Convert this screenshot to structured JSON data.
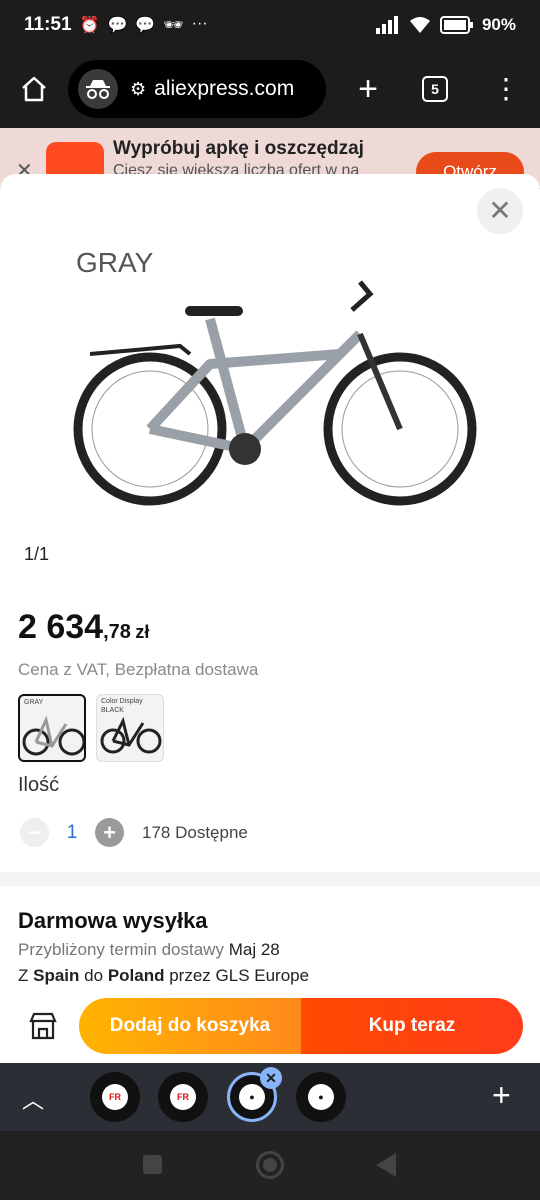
{
  "status_bar": {
    "time": "11:51",
    "battery": "90%"
  },
  "browser": {
    "url": "aliexpress.com",
    "tab_count": "5"
  },
  "promo": {
    "title": "Wypróbuj apkę i oszczędzaj",
    "subtitle": "Ciesz się większą liczbą ofert w na",
    "open_label": "Otwórz"
  },
  "product": {
    "image_caption": "GRAY",
    "image_counter": "1/1",
    "price_main": "2 634",
    "price_cents": ",78",
    "price_currency": "zł",
    "price_note": "Cena z VAT, Bezpłatna dostawa",
    "variants": [
      {
        "label": "GRAY",
        "selected": true
      },
      {
        "label": "Color Display",
        "sub": "BLACK",
        "selected": false
      }
    ],
    "quantity_label": "Ilość",
    "quantity": "1",
    "available": "178 Dostępne"
  },
  "shipping": {
    "title": "Darmowa wysyłka",
    "delivery_prefix": "Przybliżony termin dostawy",
    "delivery_date": "Maj 28",
    "from_prefix": "Z",
    "from": "Spain",
    "to_prefix": "do",
    "to": "Poland",
    "carrier": "przez GLS Europe"
  },
  "actions": {
    "add_to_cart": "Dodaj do koszyka",
    "buy_now": "Kup teraz"
  },
  "colors": {
    "cart": "#ff9c0a",
    "buy": "#ff4400",
    "tab_active": "#8ab4f8"
  }
}
